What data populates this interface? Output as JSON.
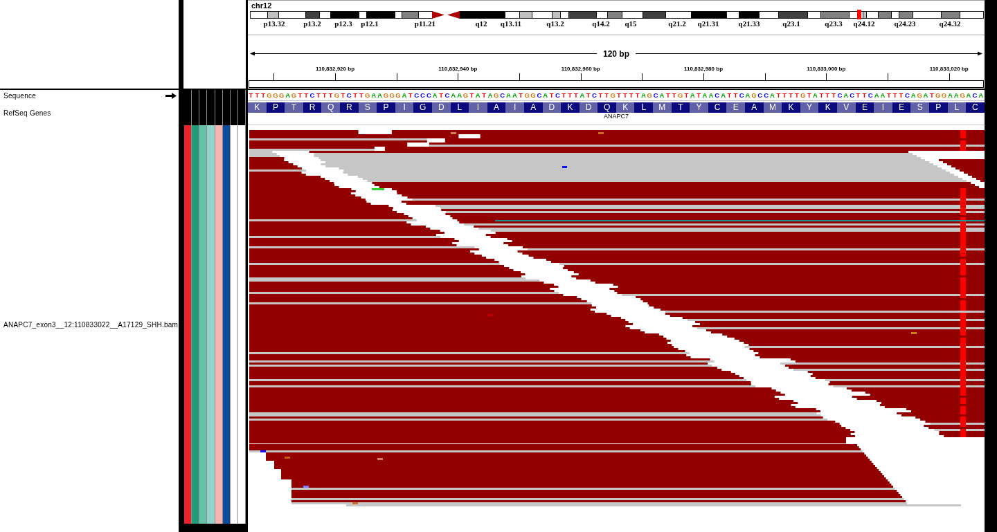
{
  "header": {
    "chromosome": "chr12",
    "cytobands": [
      "p13.32",
      "p13.2",
      "p12.3",
      "p12.1",
      "p11.21",
      "q12",
      "q13.11",
      "q13.2",
      "q14.2",
      "q15",
      "q21.2",
      "q21.31",
      "q21.33",
      "q23.1",
      "q23.3",
      "q24.12",
      "q24.23",
      "q24.32"
    ],
    "ruler": {
      "span": "120 bp",
      "ticks": [
        "110,832,920 bp",
        "110,832,940 bp",
        "110,832,960 bp",
        "110,832,980 bp",
        "110,833,000 bp",
        "110,833,020 bp"
      ]
    }
  },
  "tracks": [
    {
      "kind": "sequence",
      "name": "Sequence",
      "bases": [
        "T",
        "T",
        "T",
        "G",
        "G",
        "G",
        "A",
        "G",
        "T",
        "T",
        "C",
        "T",
        "T",
        "T",
        "G",
        "T",
        "C",
        "T",
        "T",
        "G",
        "A",
        "A",
        "G",
        "G",
        "G",
        "A",
        "T",
        "C",
        "C",
        "C",
        "A",
        "T",
        "C",
        "A",
        "A",
        "G",
        "T",
        "A",
        "T",
        "A",
        "G",
        "C",
        "A",
        "A",
        "T",
        "G",
        "G",
        "C",
        "A",
        "T",
        "C",
        "T",
        "T",
        "T",
        "A",
        "T",
        "C",
        "T",
        "T",
        "G",
        "T",
        "T",
        "T",
        "T",
        "A",
        "G",
        "C",
        "A",
        "T",
        "T",
        "G",
        "T",
        "A",
        "T",
        "A",
        "A",
        "C",
        "A",
        "T",
        "T",
        "C",
        "A",
        "G",
        "C",
        "C",
        "A",
        "T",
        "T",
        "T",
        "T",
        "G",
        "T",
        "A",
        "T",
        "T",
        "T",
        "C",
        "A",
        "C",
        "T",
        "T",
        "C",
        "A",
        "A",
        "T",
        "T",
        "T",
        "C",
        "A",
        "G",
        "A",
        "T",
        "G",
        "G",
        "A",
        "A",
        "G",
        "A",
        "C",
        "A"
      ]
    },
    {
      "kind": "gene",
      "name": "RefSeq Genes",
      "amino_acids": [
        "K",
        "P",
        "T",
        "R",
        "Q",
        "R",
        "S",
        "P",
        "I",
        "G",
        "D",
        "L",
        "I",
        "A",
        "I",
        "A",
        "D",
        "K",
        "D",
        "Q",
        "K",
        "L",
        "M",
        "T",
        "Y",
        "C",
        "E",
        "A",
        "M",
        "K",
        "Y",
        "K",
        "V",
        "E",
        "I",
        "E",
        "S",
        "P",
        "L",
        "C"
      ],
      "gene": "ANAPC7"
    },
    {
      "kind": "alignment",
      "name": "ANAPC7_exon3__12:110833022__A17129_SHH.bam",
      "attributes": [
        {
          "color": "#e8232b"
        },
        {
          "color": "#1f9b78"
        },
        {
          "color": "#66c2a5"
        },
        {
          "color": "#93d5cb"
        },
        {
          "color": "#f7b5b0"
        },
        {
          "color": "#0d4a9b"
        },
        {
          "color": "#ffffff"
        },
        {
          "color": "#ffffff"
        }
      ]
    }
  ]
}
